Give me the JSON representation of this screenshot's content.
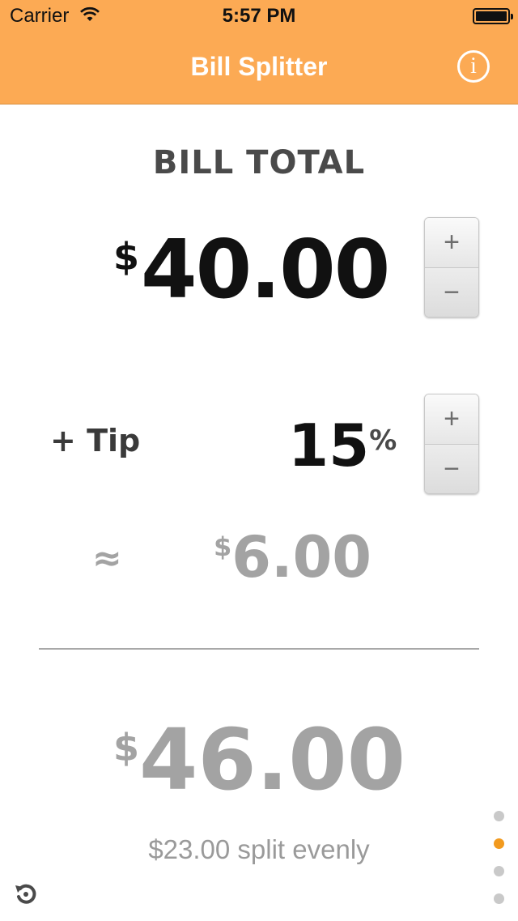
{
  "status_bar": {
    "carrier": "Carrier",
    "time": "5:57 PM"
  },
  "nav": {
    "title": "Bill Splitter",
    "info_icon": "i"
  },
  "bill": {
    "heading": "BILL TOTAL",
    "currency": "$",
    "amount": "40.00"
  },
  "tip": {
    "label": "+ Tip",
    "percent": "15",
    "percent_sign": "%",
    "approx": "≈",
    "currency": "$",
    "amount": "6.00"
  },
  "total": {
    "currency": "$",
    "amount": "46.00",
    "split_text": "$23.00 split evenly"
  },
  "steppers": {
    "plus_label": "+",
    "minus_label": "−"
  },
  "pagination": {
    "count": 4,
    "active_index": 1,
    "active_color": "#f29a1e",
    "inactive_color": "#c9c9c9"
  },
  "colors": {
    "nav_bar": "#fcaa54",
    "muted_amount": "#a3a3a3"
  },
  "icons": {
    "reset": "reset-icon",
    "info": "info-icon",
    "wifi": "wifi-icon",
    "battery": "battery-icon"
  }
}
